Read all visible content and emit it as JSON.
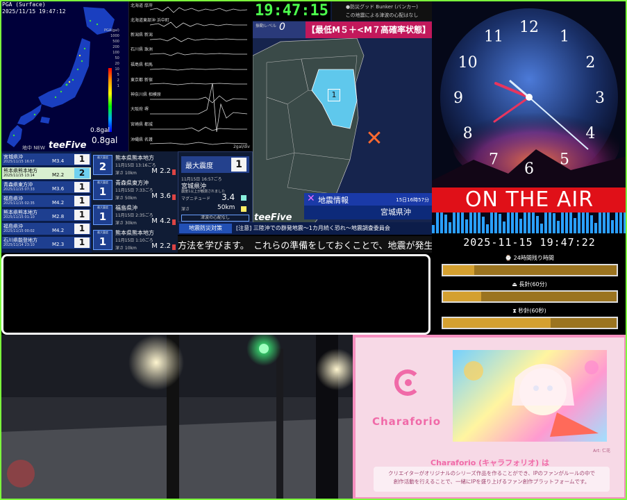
{
  "pga": {
    "title": "PGA (Surface)",
    "timestamp": "2025/11/15 19:47:12",
    "legend_label": "PGA(gal)",
    "scale_ticks": [
      "1000",
      "500",
      "200",
      "100",
      "50",
      "20",
      "10",
      "5",
      "2",
      "1"
    ],
    "min_label": "0.8gal",
    "current_value": "0.8gal",
    "new_label": "地中 NEW",
    "brand": "teeFive"
  },
  "waveforms": {
    "stations": [
      "北海道 厚岸",
      "北海道東部沖 浜中町",
      "新潟県 新潟",
      "石川県 珠洲",
      "福島県 相馬",
      "東京都 新宿",
      "神奈川県 相模原",
      "大阪府 堺",
      "宮崎県 都城",
      "沖縄県 名護"
    ],
    "unit": "2gal/div"
  },
  "list": [
    {
      "name": "宮城県沖",
      "date": "2025/11/15 16:57",
      "mag": "M3.4",
      "int": "1",
      "highlight": false
    },
    {
      "name": "熊本県熊本地方",
      "date": "2025/11/15 13:14",
      "mag": "M2.2",
      "int": "2",
      "highlight": true
    },
    {
      "name": "青森県東方沖",
      "date": "2025/11/15 07:33",
      "mag": "M3.6",
      "int": "1",
      "highlight": false
    },
    {
      "name": "福島県沖",
      "date": "2025/11/15 02:35",
      "mag": "M4.2",
      "int": "1",
      "highlight": false
    },
    {
      "name": "熊本県熊本地方",
      "date": "2025/11/15 01:10",
      "mag": "M2.8",
      "int": "1",
      "highlight": false
    },
    {
      "name": "福島県沖",
      "date": "2025/11/15 00:02",
      "mag": "M4.2",
      "int": "1",
      "highlight": false
    },
    {
      "name": "石川県能登地方",
      "date": "2025/11/14 23:10",
      "mag": "M2.3",
      "int": "1",
      "highlight": false
    }
  ],
  "detail": [
    {
      "label": "最大震度",
      "int": "2",
      "name": "熊本県熊本地方",
      "date": "11月15日 13:16ごろ",
      "depth": "深さ 10km",
      "mag": "M 2.2"
    },
    {
      "label": "最大震度",
      "int": "1",
      "name": "青森県東方沖",
      "date": "11月15日 7:33ごろ",
      "depth": "深さ 50km",
      "mag": "M 3.6"
    },
    {
      "label": "最大震度",
      "int": "1",
      "name": "福島県沖",
      "date": "11月15日 2:35ごろ",
      "depth": "深さ 30km",
      "mag": "M 4.2"
    },
    {
      "label": "最大震度",
      "int": "1",
      "name": "熊本県熊本地方",
      "date": "11月15日 1:10ごろ",
      "depth": "深さ 10km",
      "mag": "M 2.2"
    }
  ],
  "maxp": {
    "label": "最大震度",
    "value": "1",
    "time": "11月15日 16:57ごろ",
    "region": "宮城県沖",
    "note": "震度1以上が観測されました",
    "mag_label": "マグニチュード",
    "mag_value": "3.4",
    "depth_label": "深さ",
    "depth_value": "50km",
    "tsunami": "津波の心配なし"
  },
  "map": {
    "clock": "19:47:15",
    "bunker_title": "●防災グッド Bunker (バンカー)",
    "bunker_note": "この地震による津波の心配はなし",
    "level_label": "振動レベル",
    "level_value": "0",
    "warning": "【最低M５＋<M７高確率状態】",
    "info_label": "地震情報",
    "info_date": "15日16時57分",
    "region": "宮城県沖",
    "region_int": "1",
    "brand": "teeFive"
  },
  "space": {
    "on_air": "ON THE AIR",
    "numbers": [
      "12",
      "1",
      "2",
      "3",
      "4",
      "5",
      "6",
      "7",
      "8",
      "9",
      "10",
      "11"
    ]
  },
  "banner": {
    "tag": "地震防災対策",
    "message": "[注意] 三陸沖での群発地震〜1カ月続く恐れ〜地震調査委員会"
  },
  "ticker": {
    "text": "方法を学びます。　これらの準備をしておくことで、地震が発生した際に"
  },
  "timer": {
    "datetime": "2025-11-15 19:47:22",
    "label1": "⌚ 24時間残り時間",
    "label2": "⏏ 長針(60分)",
    "label3": "⧗ 秒針(60秒)",
    "progress1": 0.18,
    "progress2": 0.22,
    "progress3": 0.62
  },
  "promo": {
    "logo": "Charaforio",
    "credit": "Art: 仁花",
    "title": "Charaforio (キャラフォリオ) は",
    "desc1": "クリエイターがオリジナルのシリーズ作品を作ることができ、IPのファンがルールの中で",
    "desc2": "創作活動を行えることで、一緒にIPを盛り上げるファン創作プラットフォームです。"
  },
  "colors": {
    "accent_green": "#4cff4c",
    "warning_pink": "#c2185b",
    "on_air_red": "#e01018",
    "promo_pink": "#f06aa8"
  }
}
